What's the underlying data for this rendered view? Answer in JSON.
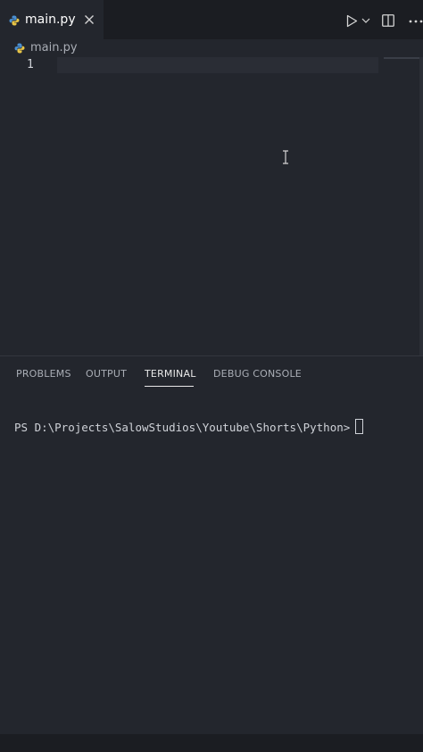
{
  "tab": {
    "filename": "main.py",
    "file_icon": "python-icon",
    "close_icon": "close-icon"
  },
  "toolbar": {
    "run_icon": "play-icon",
    "run_menu_icon": "chevron-down-icon",
    "split_icon": "split-editor-icon"
  },
  "breadcrumb": {
    "filename": "main.py",
    "file_icon": "python-icon"
  },
  "editor": {
    "line_numbers": [
      "1"
    ]
  },
  "panel": {
    "tabs": [
      {
        "label": "PROBLEMS",
        "active": false
      },
      {
        "label": "OUTPUT",
        "active": false
      },
      {
        "label": "TERMINAL",
        "active": true
      },
      {
        "label": "DEBUG CONSOLE",
        "active": false
      }
    ],
    "terminal_prompt": "PS D:\\Projects\\SalowStudios\\Youtube\\Shorts\\Python>"
  },
  "colors": {
    "background": "#23262d",
    "tabbar": "#1b1d22",
    "python_blue": "#4a8fd1",
    "python_yellow": "#e8c547",
    "text": "#d4d4d4"
  }
}
